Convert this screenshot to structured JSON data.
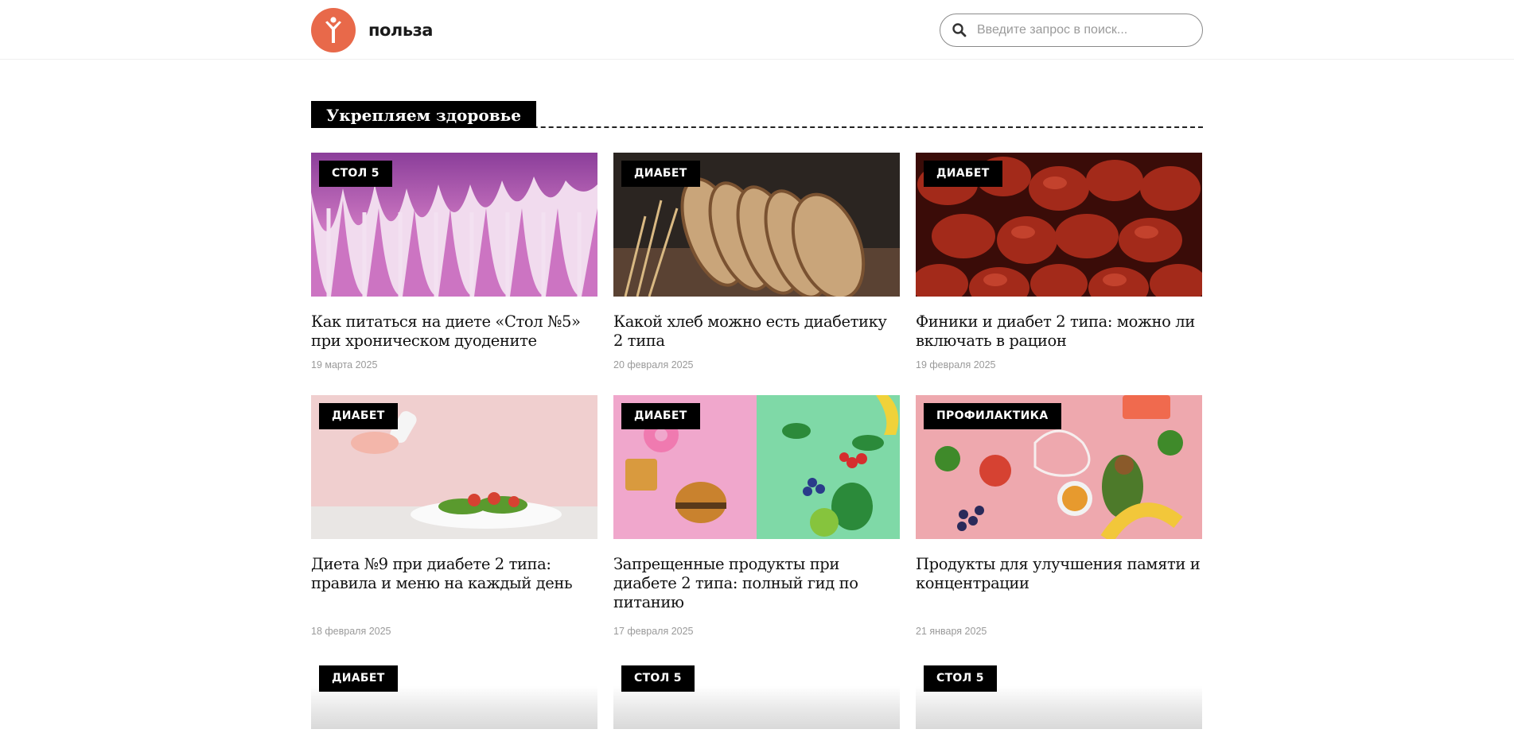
{
  "site": {
    "logo_text": "польза",
    "brand_color": "#e8694a"
  },
  "search": {
    "placeholder": "Введите запрос в поиск...",
    "icon": "search-icon"
  },
  "section": {
    "title": "Укрепляем здоровье"
  },
  "articles": [
    {
      "category": "СТОЛ 5",
      "title": "Как питаться на диете «Стол №5» при хроническом дуодените",
      "date": "19 марта 2025",
      "image": "intestinal-tissue-micrograph"
    },
    {
      "category": "ДИАБЕТ",
      "title": "Какой хлеб можно есть диабетику 2 типа",
      "date": "20 февраля 2025",
      "image": "sliced-bread"
    },
    {
      "category": "ДИАБЕТ",
      "title": "Финики и диабет 2 типа: можно ли включать в рацион",
      "date": "19 февраля 2025",
      "image": "dates-fruit"
    },
    {
      "category": "ДИАБЕТ",
      "title": "Диета №9 при диабете 2 типа: правила и меню на каждый день",
      "date": "18 февраля 2025",
      "image": "salting-salad"
    },
    {
      "category": "ДИАБЕТ",
      "title": "Запрещенные продукты при диабете 2 типа: полный гид по питанию",
      "date": "17 февраля 2025",
      "image": "junk-vs-healthy-food"
    },
    {
      "category": "ПРОФИЛАКТИКА",
      "title": "Продукты для улучшения памяти и концентрации",
      "date": "21 января 2025",
      "image": "brain-food"
    },
    {
      "category": "ДИАБЕТ"
    },
    {
      "category": "СТОЛ 5"
    },
    {
      "category": "СТОЛ 5"
    }
  ]
}
